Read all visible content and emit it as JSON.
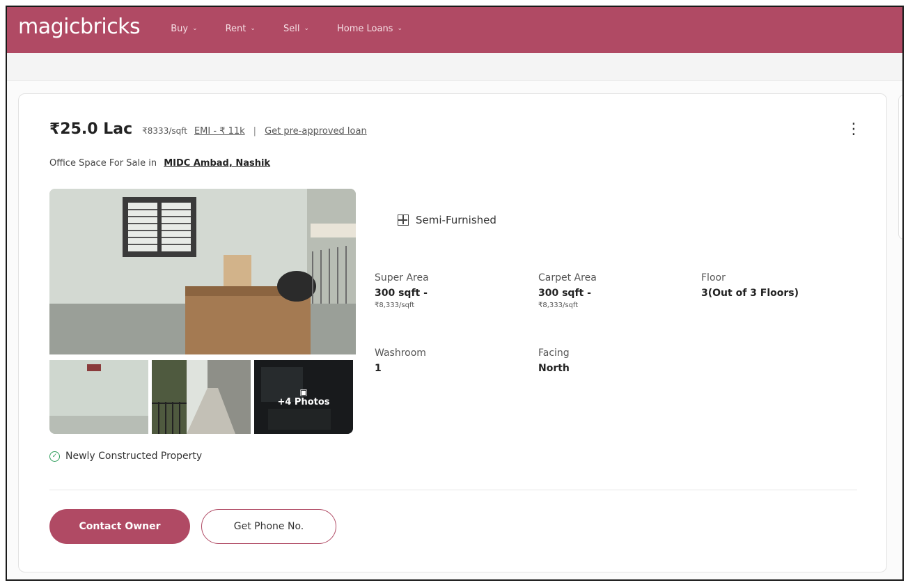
{
  "header": {
    "logo": "magicbricks",
    "nav": [
      {
        "label": "Buy"
      },
      {
        "label": "Rent"
      },
      {
        "label": "Sell"
      },
      {
        "label": "Home Loans"
      }
    ]
  },
  "listing": {
    "price": "₹25.0 Lac",
    "price_per_sqft": "₹8333/sqft",
    "emi": "EMI - ₹ 11k",
    "separator": "|",
    "preapproved": "Get pre-approved loan",
    "subtitle_prefix": "Office Space For Sale in",
    "location": "MIDC Ambad, Nashik",
    "furnishing": "Semi-Furnished",
    "more_photos": "+4 Photos",
    "badge": "Newly Constructed Property",
    "specs": {
      "super_area": {
        "label": "Super Area",
        "value": "300 sqft -",
        "sub": "₹8,333/sqft"
      },
      "carpet_area": {
        "label": "Carpet Area",
        "value": "300 sqft -",
        "sub": "₹8,333/sqft"
      },
      "floor": {
        "label": "Floor",
        "value": "3(Out of 3 Floors)"
      },
      "washroom": {
        "label": "Washroom",
        "value": "1"
      },
      "facing": {
        "label": "Facing",
        "value": "North"
      }
    },
    "buttons": {
      "contact": "Contact Owner",
      "phone": "Get Phone No."
    }
  },
  "colors": {
    "brand": "#b04a64",
    "verified": "#2e9e5b"
  },
  "icons": [
    "chevron-down-icon",
    "kebab-menu-icon",
    "furnish-icon",
    "check-circle-icon",
    "photo-icon"
  ]
}
